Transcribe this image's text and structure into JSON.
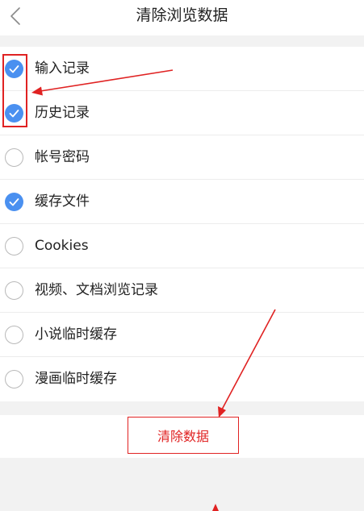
{
  "header": {
    "title": "清除浏览数据"
  },
  "items": [
    {
      "label": "输入记录",
      "checked": true
    },
    {
      "label": "历史记录",
      "checked": true
    },
    {
      "label": "帐号密码",
      "checked": false
    },
    {
      "label": "缓存文件",
      "checked": true
    },
    {
      "label": "Cookies",
      "checked": false
    },
    {
      "label": "视频、文档浏览记录",
      "checked": false
    },
    {
      "label": "小说临时缓存",
      "checked": false
    },
    {
      "label": "漫画临时缓存",
      "checked": false
    }
  ],
  "clear_button": {
    "label": "清除数据"
  },
  "colors": {
    "accent": "#4a90f0",
    "annotation": "#e02222",
    "background": "#f2f2f2"
  }
}
